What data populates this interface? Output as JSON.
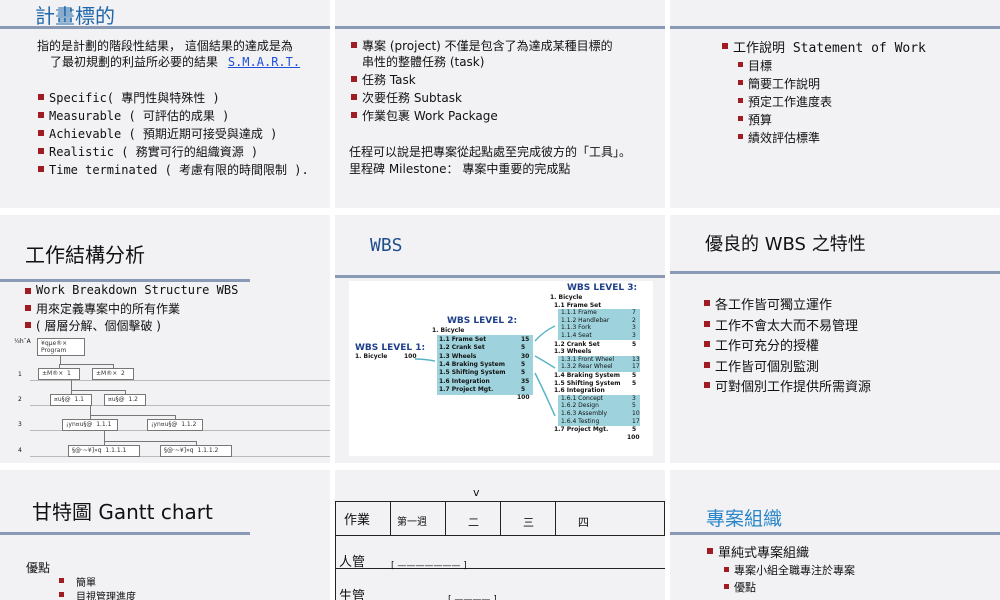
{
  "s1": {
    "title": "計畫標的",
    "intro_line1": "指的是計劃的階段性結果， 這個結果的達成是為",
    "intro_line2": "了最初規劃的利益所必要的結果",
    "smart_link": "S.M.A.R.T.",
    "items": [
      "Specific( 專門性與特殊性 )",
      "Measurable ( 可評估的成果 )",
      "Achievable ( 預期近期可接受與達成 )",
      "Realistic ( 務實可行的組織資源 )",
      "Time terminated ( 考慮有限的時間限制 )."
    ]
  },
  "s2": {
    "item1_line1": "專案 (project) 不僅是包含了為達成某種目標的",
    "item1_line2": "串性的整體任務 (task)",
    "items": [
      "任務 Task",
      "次要任務 Subtask",
      "作業包裹  Work Package"
    ],
    "para1": "任程可以說是把專案從起點處至完成彼方的「工具」。",
    "para2": "里程碑 Milestone： 專案中重要的完成點"
  },
  "s3": {
    "main": "工作說明 Statement of Work",
    "subs": [
      "目標",
      "簡要工作說明",
      "預定工作進度表",
      "預算",
      "績效評估標準"
    ]
  },
  "s4": {
    "title": "工作結構分析",
    "items": [
      "Work Breakdown Structure WBS",
      "用來定義專案中的所有作業",
      "( 層層分解、個個擊破 )"
    ],
    "diagram": {
      "axis_label": "¼h¯A",
      "levels": [
        "1",
        "2",
        "3",
        "4"
      ],
      "root": "¥qµe®×\nProgram",
      "l1": [
        "±M®×  1",
        "±M®×  2"
      ],
      "l2": [
        "¤u§@  1.1",
        "¤u§@  1.2"
      ],
      "l3": [
        "¡yn¤u§@  1.1.1",
        "¡yn¤u§@  1.1.2"
      ],
      "l4": [
        "§@·~¥]»q  1.1.1.1",
        "§@·~¥]»q  1.1.1.2"
      ]
    }
  },
  "s5": {
    "title": "WBS",
    "level1": {
      "heading": "WBS LEVEL 1:",
      "item": "1. Bicycle",
      "value": "100"
    },
    "level2": {
      "heading": "WBS LEVEL 2:",
      "parent": "1. Bicycle",
      "rows": [
        {
          "label": "1.1 Frame Set",
          "value": "15"
        },
        {
          "label": "1.2 Crank Set",
          "value": "5"
        },
        {
          "label": "1.3 Wheels",
          "value": "30"
        },
        {
          "label": "1.4 Braking System",
          "value": "5"
        },
        {
          "label": "1.5 Shifting System",
          "value": "5"
        },
        {
          "label": "1.6 Integration",
          "value": "35"
        },
        {
          "label": "1.7 Project Mgt.",
          "value": "5"
        }
      ],
      "total": "100"
    },
    "level3": {
      "heading": "WBS LEVEL 3:",
      "parent": "1. Bicycle",
      "groups": [
        {
          "label": "1.1 Frame Set",
          "value": "",
          "rows": [
            {
              "label": "1.1.1 Frame",
              "value": "7"
            },
            {
              "label": "1.1.2 Handlebar",
              "value": "2"
            },
            {
              "label": "1.1.3 Fork",
              "value": "3"
            },
            {
              "label": "1.1.4 Seat",
              "value": "3"
            }
          ]
        },
        {
          "label": "1.2 Crank Set",
          "value": "5",
          "rows": []
        },
        {
          "label": "1.3 Wheels",
          "value": "",
          "rows": [
            {
              "label": "1.3.1 Front Wheel",
              "value": "13"
            },
            {
              "label": "1.3.2 Rear Wheel",
              "value": "17"
            }
          ]
        },
        {
          "label": "1.4 Braking System",
          "value": "5",
          "rows": []
        },
        {
          "label": "1.5 Shifting System",
          "value": "5",
          "rows": []
        },
        {
          "label": "1.6 Integration",
          "value": "",
          "rows": [
            {
              "label": "1.6.1 Concept",
              "value": "3"
            },
            {
              "label": "1.6.2 Design",
              "value": "5"
            },
            {
              "label": "1.6.3 Assembly",
              "value": "10"
            },
            {
              "label": "1.6.4 Testing",
              "value": "17"
            }
          ]
        },
        {
          "label": "1.7 Project Mgt.",
          "value": "5",
          "rows": []
        }
      ],
      "total": "100"
    }
  },
  "s6": {
    "title": "優良的 WBS 之特性",
    "items": [
      "各工作皆可獨立運作",
      "工作不會太大而不易管理",
      "工作可充分的授權",
      "工作皆可個別監測",
      "可對個別工作提供所需資源"
    ]
  },
  "s7": {
    "title": "甘特圖 Gantt chart",
    "heading": "優點",
    "items": [
      "簡單",
      "目視管理進度"
    ]
  },
  "s8": {
    "top_mark": "v",
    "header_first": "作業",
    "weeks": [
      "第一週",
      "二",
      "三",
      "四"
    ],
    "rows": [
      {
        "label": "人管",
        "bar": "[ ———————  ]"
      },
      {
        "label": "生管",
        "bar": "[ ————  ]"
      }
    ]
  },
  "s9": {
    "title": "專案組織",
    "main": "單純式專案組織",
    "subs": [
      "專案小組全職專注於專案",
      "優點"
    ]
  }
}
